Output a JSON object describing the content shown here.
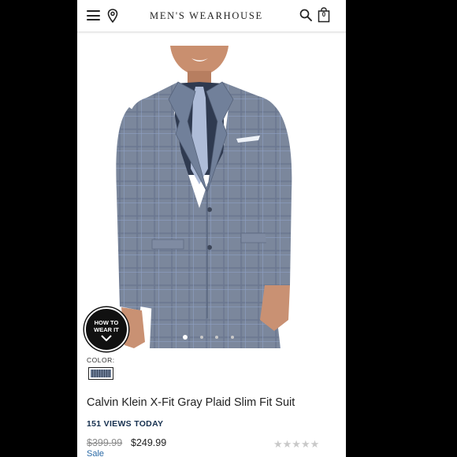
{
  "header": {
    "logo": "MEN'S WEARHOUSE",
    "bag_count": "0",
    "icons": [
      "hamburger-menu-icon",
      "location-pin-icon",
      "search-icon",
      "shopping-bag-icon"
    ]
  },
  "gallery": {
    "how_to_wear": "HOW TO\nWEAR IT",
    "dot_count": 4,
    "active_dot": 0
  },
  "color": {
    "label": "COLOR:",
    "swatch_color": "#5a6882"
  },
  "product": {
    "title": "Calvin Klein X-Fit Gray Plaid Slim Fit Suit",
    "views": "151 VIEWS TODAY",
    "original_price": "$399.99",
    "sale_price": "$249.99",
    "sale_label": "Sale",
    "rating_stars": "★★★★★",
    "rating_value": 0
  },
  "colors": {
    "page_background": "#000000",
    "accent_navy": "#16304f",
    "sale_blue": "#2b6aa6",
    "suit_gray": "#7b879c"
  }
}
